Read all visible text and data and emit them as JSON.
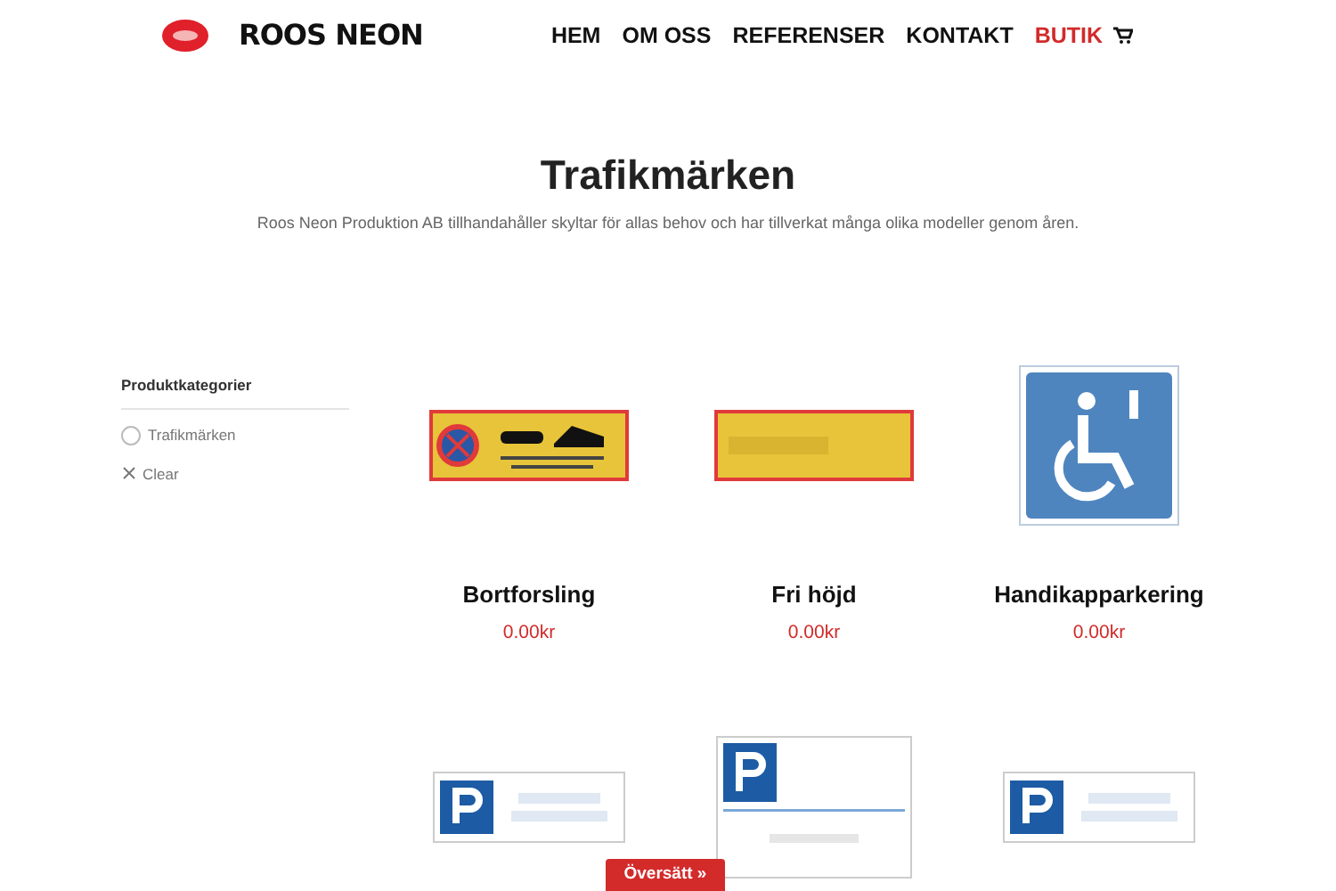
{
  "header": {
    "logo_text": "ROOS NEON",
    "nav": [
      {
        "label": "HEM",
        "selected": false
      },
      {
        "label": "OM OSS",
        "selected": false
      },
      {
        "label": "REFERENSER",
        "selected": false
      },
      {
        "label": "KONTAKT",
        "selected": false
      },
      {
        "label": "BUTIK",
        "selected": true
      }
    ]
  },
  "page": {
    "title": "Trafikmärken",
    "subtitle": "Roos Neon Produktion AB tillhandahåller skyltar för allas behov och har tillverkat många olika modeller genom åren."
  },
  "sidebar": {
    "heading": "Produktkategorier",
    "categories": [
      {
        "label": "Trafikmärken",
        "checked": false
      }
    ],
    "clear": "Clear"
  },
  "products": [
    {
      "kind": "tow",
      "name": "Bortforsling",
      "price": "0.00kr"
    },
    {
      "kind": "height",
      "name": "Fri höjd",
      "price": "0.00kr"
    },
    {
      "kind": "disabled",
      "name": "Handikapparkering",
      "price": "0.00kr"
    },
    {
      "kind": "parking"
    },
    {
      "kind": "parking-tall"
    },
    {
      "kind": "parking"
    }
  ],
  "translate_button": "Översätt »"
}
